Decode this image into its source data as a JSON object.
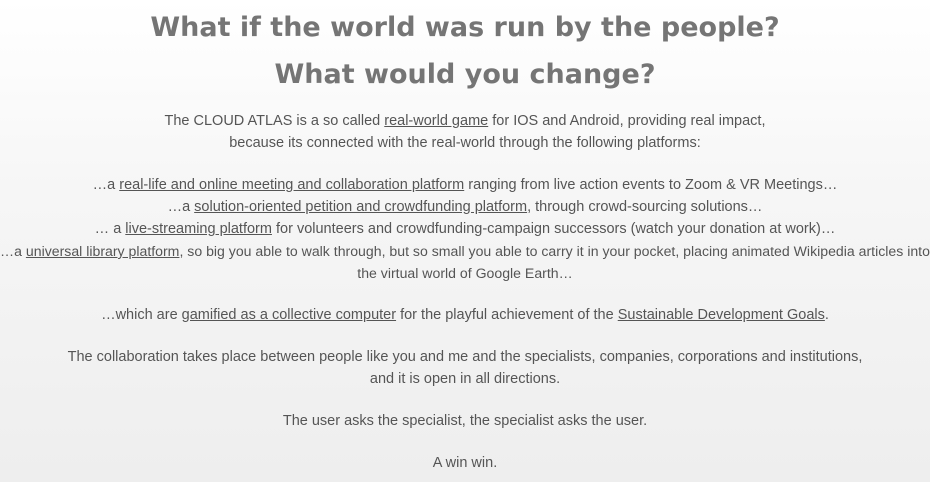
{
  "headline": {
    "line1": "What if the world was run by the people?",
    "line2": "What would you change?"
  },
  "intro": {
    "pre": "The CLOUD ATLAS is a so called ",
    "link": "real-world game",
    "post": " for IOS and Android, providing real impact,",
    "line2": "because its connected with the real-world through the following platforms:"
  },
  "platforms": [
    {
      "pre": "…a ",
      "link": "real-life and online meeting and collaboration platform",
      "post": " ranging from live action events to Zoom & VR Meetings…"
    },
    {
      "pre": "…a ",
      "link": "solution-oriented petition and crowdfunding platform",
      "post": ", through crowd-sourcing solutions…"
    },
    {
      "pre": "… a ",
      "link": "live-streaming platform",
      "post": " for volunteers and crowdfunding-campaign successors (watch your donation at work)…"
    },
    {
      "pre": "…a ",
      "link": "universal library platform",
      "post": ", so big you able to walk through, but so small you able to carry it in your pocket, placing animated Wikipedia articles into",
      "line2": "the virtual world of Google Earth…"
    }
  ],
  "gamified": {
    "pre": "…which are ",
    "link1": "gamified as a collective computer",
    "mid": " for the playful achievement of the ",
    "link2": "Sustainable Development Goals",
    "post": "."
  },
  "collab": {
    "line1": "The collaboration takes place between people like you and me and the specialists, companies, corporations and institutions,",
    "line2": "and it is open in all directions."
  },
  "user_line": "The user asks the specialist, the specialist asks the user.",
  "win_line": "A win win."
}
